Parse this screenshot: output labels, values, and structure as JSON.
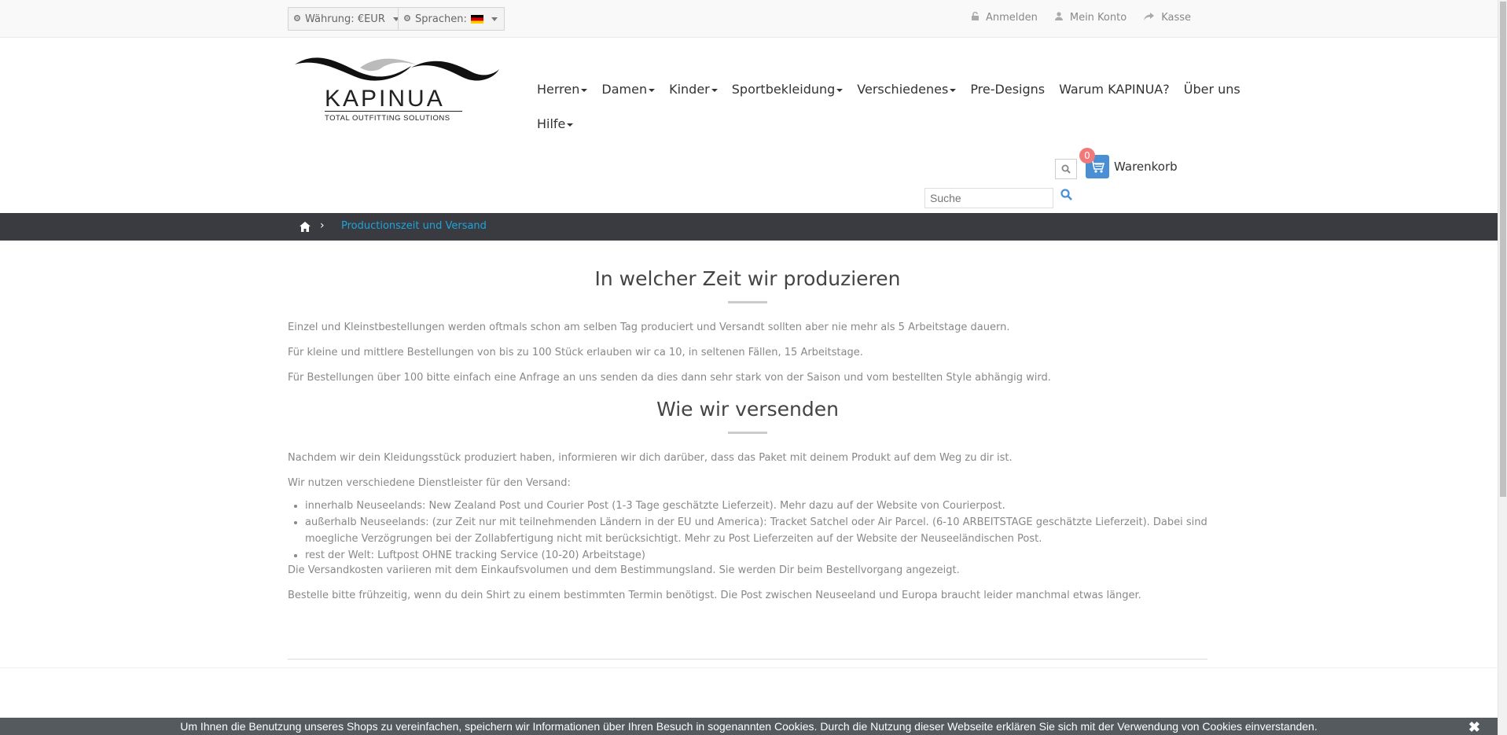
{
  "topbar": {
    "currency_label": "Währung: €EUR",
    "language_label": "Sprachen:",
    "links": [
      {
        "label": "Anmelden",
        "icon": "lock-icon"
      },
      {
        "label": "Mein Konto",
        "icon": "user-icon"
      },
      {
        "label": "Kasse",
        "icon": "share-icon"
      }
    ]
  },
  "logo": {
    "name": "KAPINUA",
    "tagline": "TOTAL OUTFITTING SOLUTIONS"
  },
  "nav": {
    "row1": [
      {
        "label": "Herren",
        "dropdown": true
      },
      {
        "label": "Damen",
        "dropdown": true
      },
      {
        "label": "Kinder",
        "dropdown": true
      },
      {
        "label": "Sportbekleidung",
        "dropdown": true
      },
      {
        "label": "Verschiedenes",
        "dropdown": true
      },
      {
        "label": "Pre-Designs",
        "dropdown": false
      },
      {
        "label": "Warum KAPINUA?",
        "dropdown": false
      },
      {
        "label": "Über uns",
        "dropdown": false
      }
    ],
    "row2": [
      {
        "label": "Hilfe",
        "dropdown": true
      }
    ]
  },
  "cart": {
    "count": "0",
    "label": "Warenkorb"
  },
  "search": {
    "placeholder": "Suche"
  },
  "breadcrumb": {
    "current": "Productionszeit und Versand"
  },
  "content": {
    "h1": "In welcher Zeit wir produzieren",
    "p1": "Einzel und Kleinstbestellungen werden oftmals schon am selben Tag produciert und Versandt sollten aber nie mehr als 5 Arbeitstage dauern.",
    "p2": "Für kleine und mittlere Bestellungen von bis zu 100 Stück erlauben wir ca 10, in seltenen Fällen, 15 Arbeitstage.",
    "p3": "Für Bestellungen über 100 bitte einfach eine Anfrage an uns senden da dies dann sehr stark von der Saison und vom bestellten Style abhängig wird.",
    "h2": "Wie wir versenden",
    "p4": "Nachdem wir dein Kleidungsstück produziert haben, informieren wir dich darüber, dass das Paket mit deinem Produkt auf dem Weg zu dir ist.",
    "p5": "Wir nutzen verschiedene Dienstleister für den Versand:",
    "list": [
      "innerhalb Neuseelands: New Zealand Post und Courier Post (1-3 Tage geschätzte Lieferzeit). Mehr dazu auf der Website von Courierpost.",
      "außerhalb Neuseelands: (zur Zeit nur mit teilnehmenden Ländern in der EU und America): Tracket Satchel oder Air Parcel. (6-10 ARBEITSTAGE geschätzte Lieferzeit). Dabei sind moegliche Verzögrungen bei der Zollabfertigung nicht mit berücksichtigt. Mehr zu Post Lieferzeiten auf der Website der Neuseeländischen Post.",
      "rest der Welt: Luftpost OHNE tracking Service (10-20) Arbeitstage)"
    ],
    "p6": "Die Versandkosten variieren mit dem Einkaufsvolumen und dem Bestimmungsland. Sie werden Dir beim Bestellvorgang angezeigt.",
    "p7": "Bestelle bitte frühzeitig, wenn du dein Shirt zu einem bestimmten Termin benötigst. Die Post zwischen Neuseeland und Europa braucht leider manchmal etwas länger."
  },
  "cookie": {
    "text": "Um Ihnen die Benutzung unseres Shops zu vereinfachen, speichern wir Informationen über Ihren Besuch in sogenannten Cookies. Durch die Nutzung dieser Webseite erklären Sie sich mit der Verwendung von Cookies einverstanden.",
    "close": "✖"
  },
  "colors": {
    "accent": "#1ea3dc",
    "cart": "#4a8fd4",
    "badge": "#f27979",
    "breadcrumb_bg": "#3a3b40"
  }
}
